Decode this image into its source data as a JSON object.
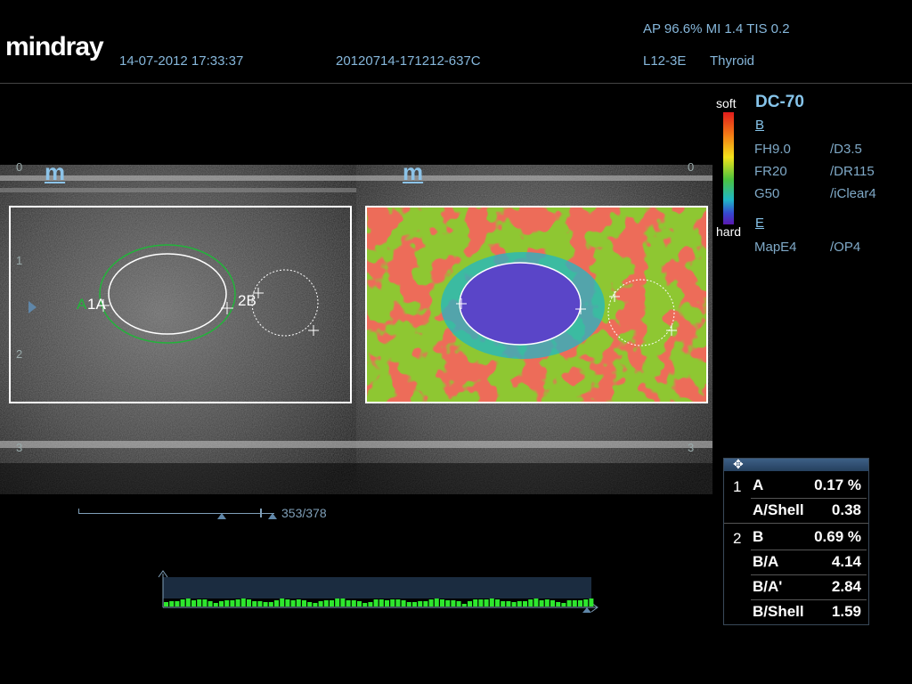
{
  "header": {
    "brand": "mindray",
    "datetime": "14-07-2012 17:33:37",
    "study_id": "20120714-171212-637C",
    "acoustic": "AP 96.6%  MI 1.4 TIS 0.2",
    "probe": "L12-3E",
    "preset": "Thyroid"
  },
  "colorbar": {
    "top_label": "soft",
    "bottom_label": "hard"
  },
  "params": {
    "title": "DC-70",
    "b_mode": "B",
    "b_rows": [
      {
        "left": "FH9.0",
        "right": "/D3.5"
      },
      {
        "left": "FR20",
        "right": "/DR115"
      },
      {
        "left": "G50",
        "right": "/iClear4"
      }
    ],
    "e_mode": "E",
    "e_rows": [
      {
        "left": "MapE4",
        "right": "/OP4"
      }
    ]
  },
  "depth_scale": [
    "0",
    "1",
    "2",
    "3"
  ],
  "panel_marker": "m",
  "annotations": {
    "a_green": "A",
    "a_white": "1A",
    "b_white": "2B"
  },
  "measurements": [
    {
      "index": "1",
      "label": "A",
      "value": "0.17 %"
    },
    {
      "index": "",
      "label": "A/Shell",
      "value": "0.38"
    },
    {
      "index": "2",
      "label": "B",
      "value": "0.69 %"
    },
    {
      "index": "",
      "label": "B/A",
      "value": "4.14"
    },
    {
      "index": "",
      "label": "B/A'",
      "value": "2.84"
    },
    {
      "index": "",
      "label": "B/Shell",
      "value": "1.59"
    }
  ],
  "cine": {
    "frame_text": "353/378"
  },
  "colors": {
    "accent": "#86b7db",
    "roi": "#ffffff",
    "ellipse_green": "#22b33a",
    "pressure_bar": "#2ee62e"
  }
}
